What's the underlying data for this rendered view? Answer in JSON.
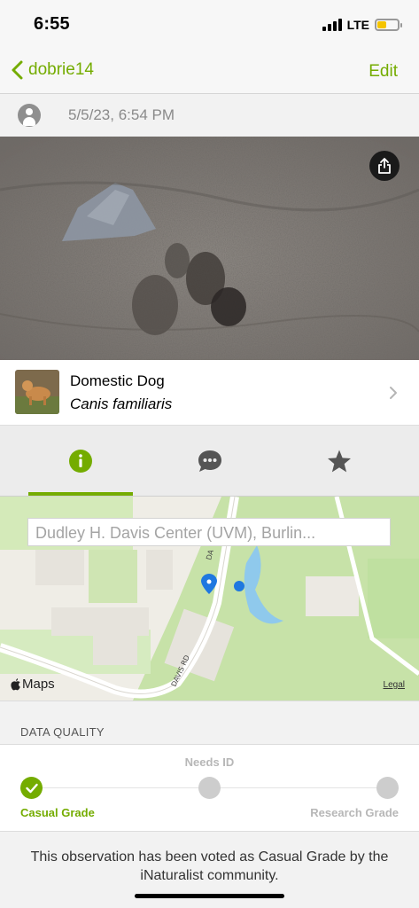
{
  "status_bar": {
    "time": "6:55",
    "network": "LTE",
    "battery_level": 0.45,
    "battery_color": "#f5c400"
  },
  "nav": {
    "back_label": "dobrie14",
    "edit_label": "Edit",
    "accent_color": "#74ac00"
  },
  "observation": {
    "date": "5/5/23, 6:54 PM",
    "share_icon": "share-icon",
    "avatar_icon": "user-avatar-icon"
  },
  "taxon": {
    "common_name": "Domestic Dog",
    "scientific_name": "Canis familiaris"
  },
  "tabs": [
    {
      "name": "info",
      "icon": "info-icon",
      "active": true
    },
    {
      "name": "activity",
      "icon": "chat-bubble-icon",
      "active": false
    },
    {
      "name": "favorites",
      "icon": "star-icon",
      "active": false
    }
  ],
  "map": {
    "search_placeholder": "Dudley H. Davis Center (UVM), Burlin...",
    "road_label": "DAVIS RD",
    "road_label_short": "DA",
    "maps_logo": "Maps",
    "legal_label": "Legal"
  },
  "data_quality": {
    "header": "DATA QUALITY",
    "grades": {
      "casual": "Casual Grade",
      "needs_id": "Needs ID",
      "research": "Research Grade"
    },
    "current": "casual",
    "vote_text": "This observation has been voted as Casual Grade by the iNaturalist community."
  }
}
